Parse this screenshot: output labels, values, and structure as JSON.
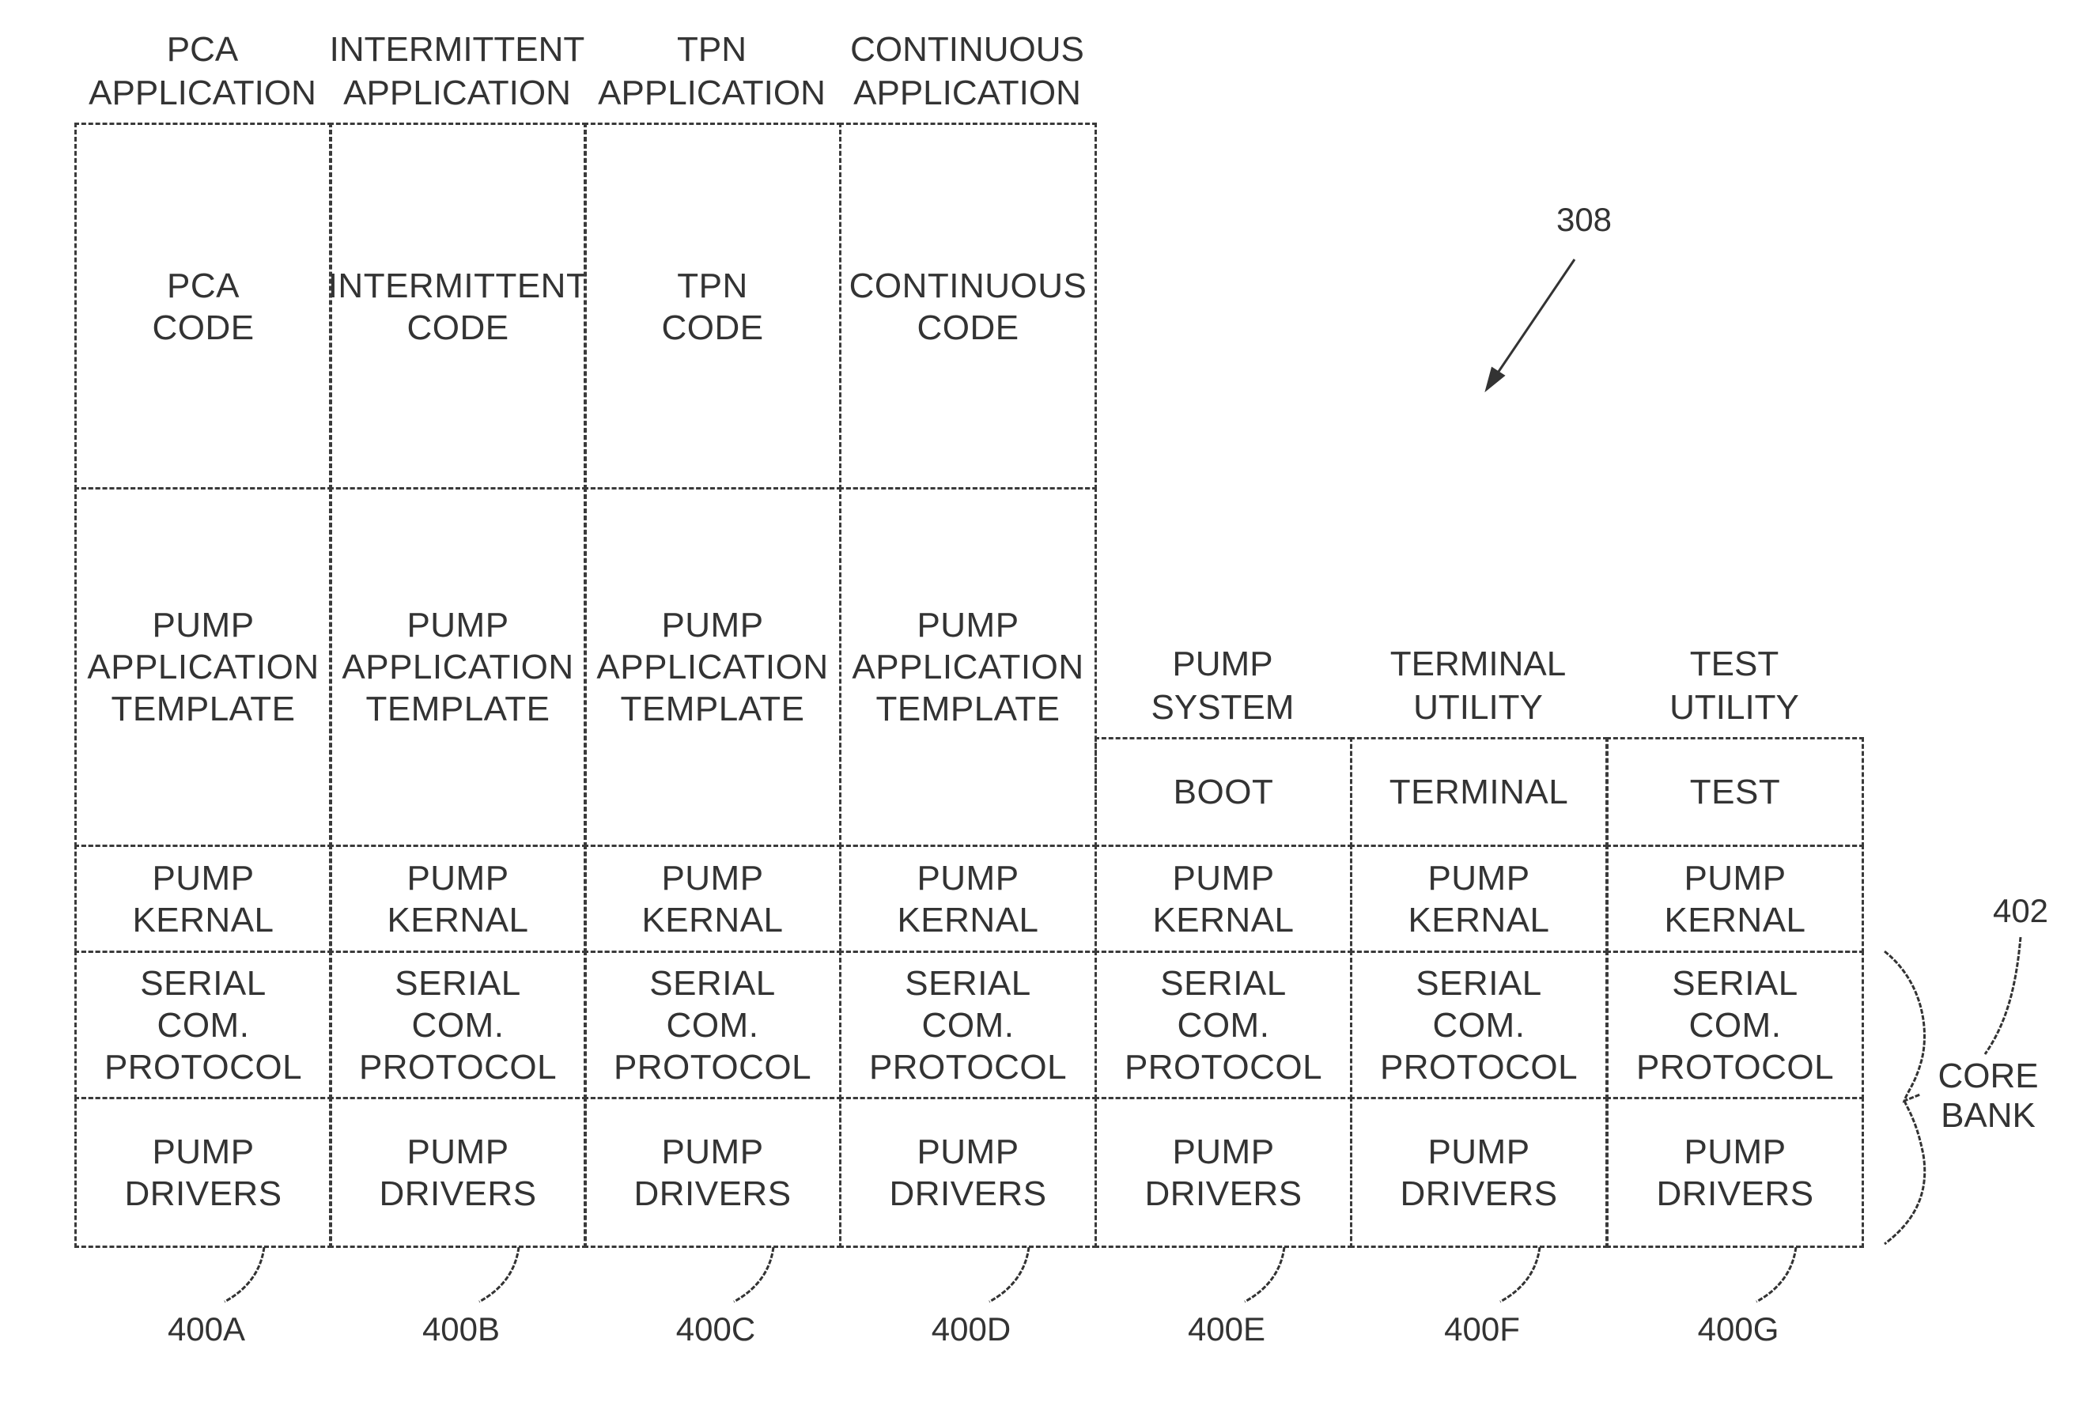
{
  "figure": {
    "reference_numeral": "308",
    "core_bank": {
      "label_line1": "CORE",
      "label_line2": "BANK",
      "reference_numeral": "402"
    }
  },
  "columns": [
    {
      "id": "400A",
      "header": [
        "PCA",
        "APPLICATION"
      ],
      "layers": {
        "code": [
          "PCA",
          "CODE"
        ],
        "template": [
          "PUMP",
          "APPLICATION",
          "TEMPLATE"
        ],
        "kernel": [
          "PUMP",
          "KERNAL"
        ],
        "serial": [
          "SERIAL",
          "COM.",
          "PROTOCOL"
        ],
        "drivers": [
          "PUMP",
          "DRIVERS"
        ]
      }
    },
    {
      "id": "400B",
      "header": [
        "INTERMITTENT",
        "APPLICATION"
      ],
      "layers": {
        "code": [
          "INTERMITTENT",
          "CODE"
        ],
        "template": [
          "PUMP",
          "APPLICATION",
          "TEMPLATE"
        ],
        "kernel": [
          "PUMP",
          "KERNAL"
        ],
        "serial": [
          "SERIAL",
          "COM.",
          "PROTOCOL"
        ],
        "drivers": [
          "PUMP",
          "DRIVERS"
        ]
      }
    },
    {
      "id": "400C",
      "header": [
        "TPN",
        "APPLICATION"
      ],
      "layers": {
        "code": [
          "TPN",
          "CODE"
        ],
        "template": [
          "PUMP",
          "APPLICATION",
          "TEMPLATE"
        ],
        "kernel": [
          "PUMP",
          "KERNAL"
        ],
        "serial": [
          "SERIAL",
          "COM.",
          "PROTOCOL"
        ],
        "drivers": [
          "PUMP",
          "DRIVERS"
        ]
      }
    },
    {
      "id": "400D",
      "header": [
        "CONTINUOUS",
        "APPLICATION"
      ],
      "layers": {
        "code": [
          "CONTINUOUS",
          "CODE"
        ],
        "template": [
          "PUMP",
          "APPLICATION",
          "TEMPLATE"
        ],
        "kernel": [
          "PUMP",
          "KERNAL"
        ],
        "serial": [
          "SERIAL",
          "COM.",
          "PROTOCOL"
        ],
        "drivers": [
          "PUMP",
          "DRIVERS"
        ]
      }
    },
    {
      "id": "400E",
      "header": [
        "PUMP",
        "SYSTEM"
      ],
      "layers": {
        "utility": [
          "BOOT"
        ],
        "kernel": [
          "PUMP",
          "KERNAL"
        ],
        "serial": [
          "SERIAL",
          "COM.",
          "PROTOCOL"
        ],
        "drivers": [
          "PUMP",
          "DRIVERS"
        ]
      }
    },
    {
      "id": "400F",
      "header": [
        "TERMINAL",
        "UTILITY"
      ],
      "layers": {
        "utility": [
          "TERMINAL"
        ],
        "kernel": [
          "PUMP",
          "KERNAL"
        ],
        "serial": [
          "SERIAL",
          "COM.",
          "PROTOCOL"
        ],
        "drivers": [
          "PUMP",
          "DRIVERS"
        ]
      }
    },
    {
      "id": "400G",
      "header": [
        "TEST",
        "UTILITY"
      ],
      "layers": {
        "utility": [
          "TEST"
        ],
        "kernel": [
          "PUMP",
          "KERNAL"
        ],
        "serial": [
          "SERIAL",
          "COM.",
          "PROTOCOL"
        ],
        "drivers": [
          "PUMP",
          "DRIVERS"
        ]
      }
    }
  ]
}
